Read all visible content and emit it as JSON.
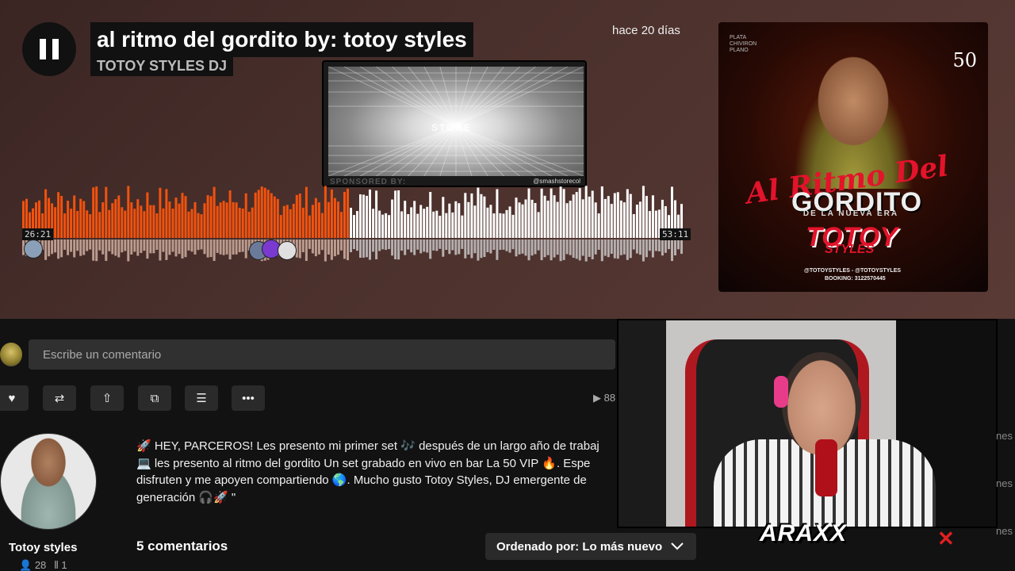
{
  "player": {
    "title": "al ritmo del gordito by: totoy styles",
    "artist": "TOTOY STYLES DJ",
    "posted": "hace 20 días",
    "current_time": "26:21",
    "duration": "53:11",
    "progress": 0.495
  },
  "sponsor": {
    "label": "SPONSORED BY:",
    "handle": "@smashstorecol",
    "logo_text": "STORE"
  },
  "cover": {
    "corner_text": "PLATA CHIVIRON PLANO",
    "number": "50",
    "script": "Al Ritmo Del",
    "big": "GORDITO",
    "sub": "DE LA NUEVA ERA",
    "brand": "TOTOY",
    "brand2": "STYLES",
    "social": "@TOTOYSTYLES - @TOTOYSTYLES",
    "booking": "BOOKING: 3122570445"
  },
  "comment": {
    "placeholder": "Escribe un comentario"
  },
  "actions": [
    {
      "name": "like",
      "glyph": "♥"
    },
    {
      "name": "repost",
      "glyph": "⇄"
    },
    {
      "name": "share",
      "glyph": "⇧"
    },
    {
      "name": "copy-link",
      "glyph": "⧉"
    },
    {
      "name": "add-to-playlist",
      "glyph": "☰"
    },
    {
      "name": "more",
      "glyph": "•••"
    }
  ],
  "plays": "▶ 88",
  "uploader": {
    "name": "Totoy styles",
    "followers": "28",
    "tracks": "1"
  },
  "description": "🚀 HEY, PARCEROS! Les presento mi primer set 🎶 después de un largo año de trabaj\n💻 les presento al ritmo del gordito Un set grabado en vivo en bar La 50 VIP 🔥. Espe\ndisfruten y me apoyen compartiendo 🌎. Mucho gusto Totoy Styles, DJ emergente de\ngeneración 🎧🚀 \"",
  "comments": {
    "count": "5 comentarios",
    "sort_label": "Ordenado por: Lo más nuevo"
  },
  "overlay": {
    "watermark": "ARAXX",
    "close": "✕",
    "edge_texts": [
      "nes",
      "nes",
      "nes"
    ]
  },
  "colors": {
    "played": "#f2520e",
    "unplayed": "#ffffff",
    "accent": "#e3132b"
  }
}
